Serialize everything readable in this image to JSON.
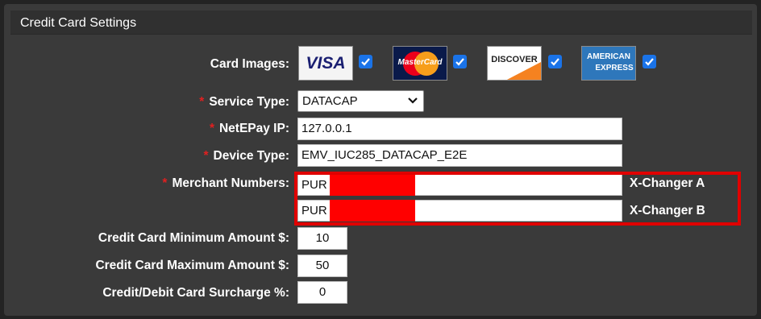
{
  "section": {
    "title": "Credit Card Settings"
  },
  "card_images": {
    "label": "Card Images:",
    "cards": [
      {
        "name": "VISA",
        "checked": true
      },
      {
        "name": "MasterCard",
        "checked": true
      },
      {
        "name": "DISCOVER",
        "checked": true
      },
      {
        "name": "AMERICAN EXPRESS",
        "checked": true
      }
    ],
    "visa_text": "VISA",
    "mastercard_text": "MasterCard",
    "discover_text": "DISCOVER",
    "amex_line1": "AMERICAN",
    "amex_line2": "EXPRESS"
  },
  "service_type": {
    "label": "Service Type:",
    "required_mark": "*",
    "value": "DATACAP"
  },
  "netepay_ip": {
    "label": "NetEPay IP:",
    "required_mark": "*",
    "value": "127.0.0.1"
  },
  "device_type": {
    "label": "Device Type:",
    "required_mark": "*",
    "value": "EMV_IUC285_DATACAP_E2E"
  },
  "merchant_numbers": {
    "label": "Merchant Numbers:",
    "required_mark": "*",
    "rows": [
      {
        "prefix": "PUR",
        "changer": "X-Changer A"
      },
      {
        "prefix": "PUR",
        "changer": "X-Changer B"
      }
    ]
  },
  "min_amount": {
    "label": "Credit Card Minimum Amount $:",
    "value": "10"
  },
  "max_amount": {
    "label": "Credit Card Maximum Amount $:",
    "value": "50"
  },
  "surcharge": {
    "label": "Credit/Debit Card Surcharge %:",
    "value": "0"
  },
  "colors": {
    "accent": "#1a73e8",
    "required": "#e02020",
    "highlight": "#e00000"
  }
}
